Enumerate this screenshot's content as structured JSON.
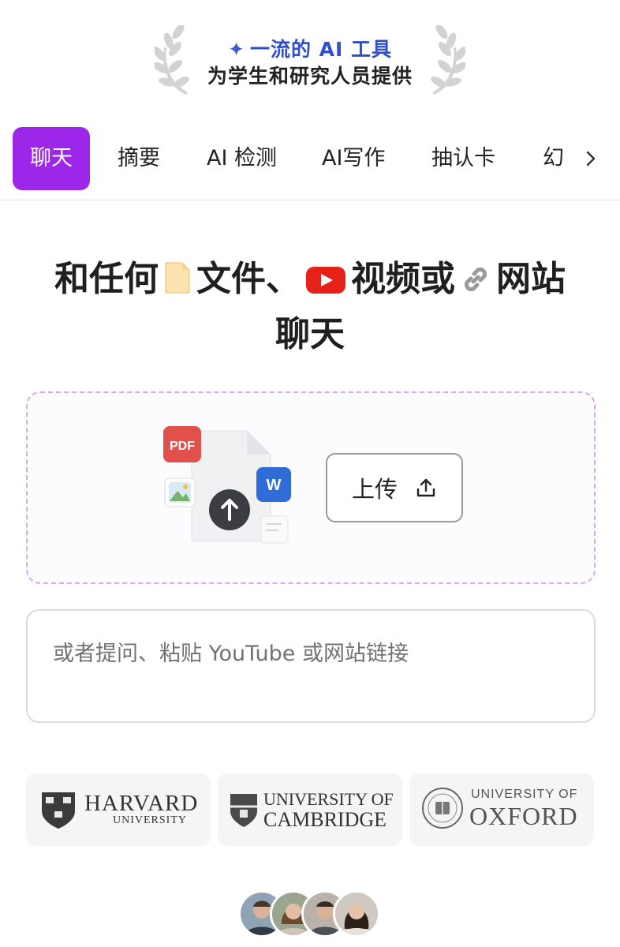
{
  "award": {
    "line1": "一流的 AI 工具",
    "line2": "为学生和研究人员提供"
  },
  "tabs": [
    {
      "label": "聊天",
      "active": true
    },
    {
      "label": "摘要",
      "active": false
    },
    {
      "label": "AI 检测",
      "active": false
    },
    {
      "label": "AI写作",
      "active": false
    },
    {
      "label": "抽认卡",
      "active": false
    },
    {
      "label": "幻",
      "active": false
    }
  ],
  "headline": {
    "part1": "和任何",
    "part2": "文件、",
    "part3": "视频或",
    "part4": "网站",
    "part5": "聊天"
  },
  "upload": {
    "button_label": "上传",
    "pdf_label": "PDF",
    "word_label": "W"
  },
  "question": {
    "placeholder": "或者提问、粘贴 YouTube 或网站链接"
  },
  "universities": {
    "harvard": {
      "name": "HARVARD",
      "sub": "UNIVERSITY"
    },
    "cambridge": {
      "line1": "UNIVERSITY OF",
      "line2": "CAMBRIDGE"
    },
    "oxford": {
      "line1": "UNIVERSITY OF",
      "line2": "OXFORD"
    }
  },
  "colors": {
    "accent": "#9c27e8",
    "award_blue": "#2f4fc9",
    "dropzone_border": "#d5a8f3"
  }
}
